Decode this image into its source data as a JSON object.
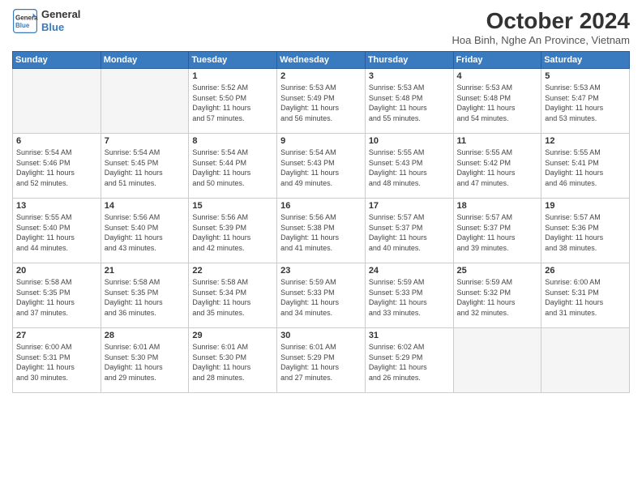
{
  "header": {
    "logo_line1": "General",
    "logo_line2": "Blue",
    "month_title": "October 2024",
    "subtitle": "Hoa Binh, Nghe An Province, Vietnam"
  },
  "weekdays": [
    "Sunday",
    "Monday",
    "Tuesday",
    "Wednesday",
    "Thursday",
    "Friday",
    "Saturday"
  ],
  "weeks": [
    [
      {
        "day": "",
        "info": ""
      },
      {
        "day": "",
        "info": ""
      },
      {
        "day": "1",
        "info": "Sunrise: 5:52 AM\nSunset: 5:50 PM\nDaylight: 11 hours\nand 57 minutes."
      },
      {
        "day": "2",
        "info": "Sunrise: 5:53 AM\nSunset: 5:49 PM\nDaylight: 11 hours\nand 56 minutes."
      },
      {
        "day": "3",
        "info": "Sunrise: 5:53 AM\nSunset: 5:48 PM\nDaylight: 11 hours\nand 55 minutes."
      },
      {
        "day": "4",
        "info": "Sunrise: 5:53 AM\nSunset: 5:48 PM\nDaylight: 11 hours\nand 54 minutes."
      },
      {
        "day": "5",
        "info": "Sunrise: 5:53 AM\nSunset: 5:47 PM\nDaylight: 11 hours\nand 53 minutes."
      }
    ],
    [
      {
        "day": "6",
        "info": "Sunrise: 5:54 AM\nSunset: 5:46 PM\nDaylight: 11 hours\nand 52 minutes."
      },
      {
        "day": "7",
        "info": "Sunrise: 5:54 AM\nSunset: 5:45 PM\nDaylight: 11 hours\nand 51 minutes."
      },
      {
        "day": "8",
        "info": "Sunrise: 5:54 AM\nSunset: 5:44 PM\nDaylight: 11 hours\nand 50 minutes."
      },
      {
        "day": "9",
        "info": "Sunrise: 5:54 AM\nSunset: 5:43 PM\nDaylight: 11 hours\nand 49 minutes."
      },
      {
        "day": "10",
        "info": "Sunrise: 5:55 AM\nSunset: 5:43 PM\nDaylight: 11 hours\nand 48 minutes."
      },
      {
        "day": "11",
        "info": "Sunrise: 5:55 AM\nSunset: 5:42 PM\nDaylight: 11 hours\nand 47 minutes."
      },
      {
        "day": "12",
        "info": "Sunrise: 5:55 AM\nSunset: 5:41 PM\nDaylight: 11 hours\nand 46 minutes."
      }
    ],
    [
      {
        "day": "13",
        "info": "Sunrise: 5:55 AM\nSunset: 5:40 PM\nDaylight: 11 hours\nand 44 minutes."
      },
      {
        "day": "14",
        "info": "Sunrise: 5:56 AM\nSunset: 5:40 PM\nDaylight: 11 hours\nand 43 minutes."
      },
      {
        "day": "15",
        "info": "Sunrise: 5:56 AM\nSunset: 5:39 PM\nDaylight: 11 hours\nand 42 minutes."
      },
      {
        "day": "16",
        "info": "Sunrise: 5:56 AM\nSunset: 5:38 PM\nDaylight: 11 hours\nand 41 minutes."
      },
      {
        "day": "17",
        "info": "Sunrise: 5:57 AM\nSunset: 5:37 PM\nDaylight: 11 hours\nand 40 minutes."
      },
      {
        "day": "18",
        "info": "Sunrise: 5:57 AM\nSunset: 5:37 PM\nDaylight: 11 hours\nand 39 minutes."
      },
      {
        "day": "19",
        "info": "Sunrise: 5:57 AM\nSunset: 5:36 PM\nDaylight: 11 hours\nand 38 minutes."
      }
    ],
    [
      {
        "day": "20",
        "info": "Sunrise: 5:58 AM\nSunset: 5:35 PM\nDaylight: 11 hours\nand 37 minutes."
      },
      {
        "day": "21",
        "info": "Sunrise: 5:58 AM\nSunset: 5:35 PM\nDaylight: 11 hours\nand 36 minutes."
      },
      {
        "day": "22",
        "info": "Sunrise: 5:58 AM\nSunset: 5:34 PM\nDaylight: 11 hours\nand 35 minutes."
      },
      {
        "day": "23",
        "info": "Sunrise: 5:59 AM\nSunset: 5:33 PM\nDaylight: 11 hours\nand 34 minutes."
      },
      {
        "day": "24",
        "info": "Sunrise: 5:59 AM\nSunset: 5:33 PM\nDaylight: 11 hours\nand 33 minutes."
      },
      {
        "day": "25",
        "info": "Sunrise: 5:59 AM\nSunset: 5:32 PM\nDaylight: 11 hours\nand 32 minutes."
      },
      {
        "day": "26",
        "info": "Sunrise: 6:00 AM\nSunset: 5:31 PM\nDaylight: 11 hours\nand 31 minutes."
      }
    ],
    [
      {
        "day": "27",
        "info": "Sunrise: 6:00 AM\nSunset: 5:31 PM\nDaylight: 11 hours\nand 30 minutes."
      },
      {
        "day": "28",
        "info": "Sunrise: 6:01 AM\nSunset: 5:30 PM\nDaylight: 11 hours\nand 29 minutes."
      },
      {
        "day": "29",
        "info": "Sunrise: 6:01 AM\nSunset: 5:30 PM\nDaylight: 11 hours\nand 28 minutes."
      },
      {
        "day": "30",
        "info": "Sunrise: 6:01 AM\nSunset: 5:29 PM\nDaylight: 11 hours\nand 27 minutes."
      },
      {
        "day": "31",
        "info": "Sunrise: 6:02 AM\nSunset: 5:29 PM\nDaylight: 11 hours\nand 26 minutes."
      },
      {
        "day": "",
        "info": ""
      },
      {
        "day": "",
        "info": ""
      }
    ]
  ]
}
